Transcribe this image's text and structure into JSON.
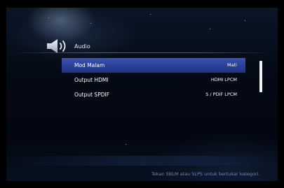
{
  "header": {
    "title": "Audio",
    "icon": "speaker-icon"
  },
  "menu": {
    "items": [
      {
        "label": "Mod Malam",
        "value": "Mati",
        "selected": true
      },
      {
        "label": "Output HDMI",
        "value": "HDMI LPCM",
        "selected": false
      },
      {
        "label": "Output SPDIF",
        "value": "S / PDIF LPCM",
        "selected": false
      }
    ]
  },
  "footer": {
    "hint": "Tekan SBLM atau SLPS untuk bertukar kategori."
  },
  "colors": {
    "selection": "#2f46a3",
    "hint_text": "#6f86b6",
    "background": "#040a15"
  }
}
